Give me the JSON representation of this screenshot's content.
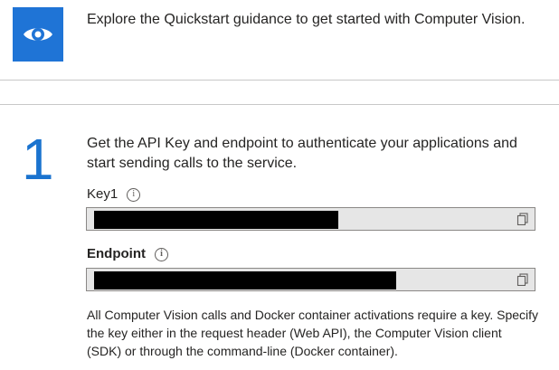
{
  "quickstart": {
    "icon": "eye-icon",
    "accent_color": "#1f74d6",
    "text": "Explore the Quickstart guidance to get started with Computer Vision."
  },
  "step1": {
    "number": "1",
    "number_color": "#1a73cf",
    "description": "Get the API Key and endpoint to authenticate your applications and start sending calls to the service.",
    "key_field": {
      "label": "Key1",
      "info_icon": "info-icon",
      "value": "",
      "copy_icon": "copy-icon"
    },
    "endpoint_field": {
      "label": "Endpoint",
      "info_icon": "info-icon",
      "value": "",
      "copy_icon": "copy-icon"
    },
    "note": "All Computer Vision calls and Docker container activations require a key. Specify the key either in the request header (Web API), the Computer Vision client (SDK) or through the command-line (Docker container)."
  }
}
